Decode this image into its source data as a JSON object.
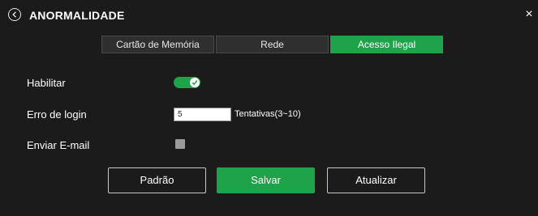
{
  "header": {
    "title": "ANORMALIDADE",
    "back_icon": "chevron-left-circle-icon",
    "close_label": "×"
  },
  "tabs": [
    {
      "label": "Cartão de Memória",
      "active": false
    },
    {
      "label": "Rede",
      "active": false
    },
    {
      "label": "Acesso Ilegal",
      "active": true
    }
  ],
  "form": {
    "enable": {
      "label": "Habilitar",
      "checked": true
    },
    "login_error": {
      "label": "Erro de login",
      "value": "5",
      "hint": "Tentativas(3~10)"
    },
    "send_email": {
      "label": "Enviar E-mail",
      "checked": false
    }
  },
  "buttons": {
    "default_label": "Padrão",
    "save_label": "Salvar",
    "refresh_label": "Atualizar"
  },
  "colors": {
    "background": "#1b1b1b",
    "accent": "#1fa34a",
    "tab_inactive": "#2f2f2f"
  }
}
